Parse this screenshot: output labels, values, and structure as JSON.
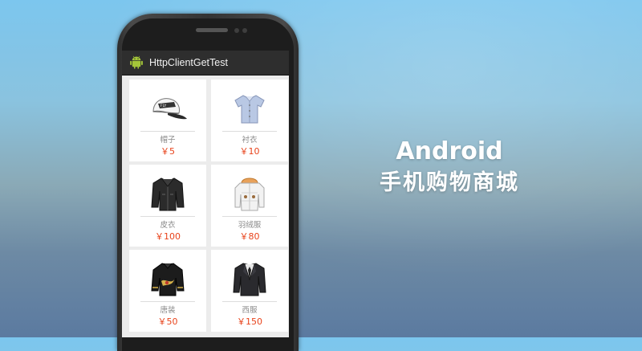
{
  "app": {
    "title": "HttpClientGetTest",
    "icon": "android-robot-icon",
    "accent_color": "#a4c639"
  },
  "products": [
    {
      "name": "帽子",
      "price": "￥5",
      "icon": "cap-icon"
    },
    {
      "name": "衬衣",
      "price": "￥10",
      "icon": "shirt-icon"
    },
    {
      "name": "皮衣",
      "price": "￥100",
      "icon": "leather-jacket-icon"
    },
    {
      "name": "羽绒服",
      "price": "￥80",
      "icon": "down-jacket-icon"
    },
    {
      "name": "唐装",
      "price": "￥50",
      "icon": "tang-suit-icon"
    },
    {
      "name": "西服",
      "price": "￥150",
      "icon": "suit-icon"
    }
  ],
  "headline": {
    "line1": "Android",
    "line2": "手机购物商城"
  },
  "colors": {
    "price": "#e8431b",
    "titlebar": "#2e2e2e",
    "screen_bg": "#ececec"
  }
}
